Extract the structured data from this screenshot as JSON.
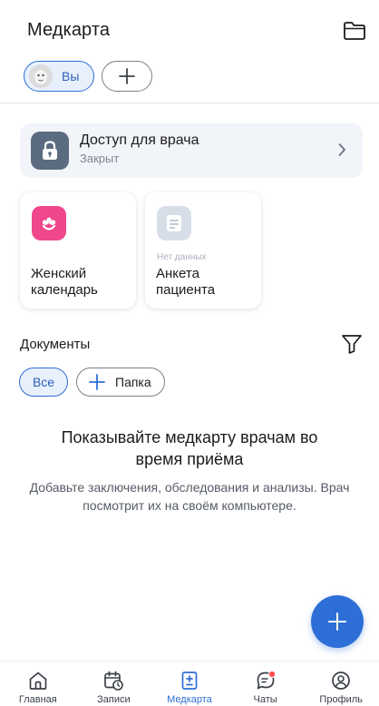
{
  "header": {
    "title": "Медкарта"
  },
  "profiles": {
    "you_label": "Вы"
  },
  "access": {
    "title": "Доступ для врача",
    "status": "Закрыт"
  },
  "tiles": [
    {
      "label": "Женский календарь",
      "nodata": ""
    },
    {
      "label": "Анкета пациента",
      "nodata": "Нет данных"
    }
  ],
  "documents": {
    "title": "Документы",
    "chip_all": "Все",
    "chip_folder": "Папка"
  },
  "empty_state": {
    "title": "Показывайте медкарту врачам во время приёма",
    "description": "Добавьте заключения, обследования и анализы. Врач посмотрит их на своём компьютере."
  },
  "tabbar": {
    "items": [
      {
        "label": "Главная",
        "icon": "home-icon"
      },
      {
        "label": "Записи",
        "icon": "calendar-clock-icon"
      },
      {
        "label": "Медкарта",
        "icon": "medcard-icon",
        "active": true
      },
      {
        "label": "Чаты",
        "icon": "chat-icon"
      },
      {
        "label": "Профиль",
        "icon": "profile-icon"
      }
    ]
  },
  "colors": {
    "accent": "#2d6fd6",
    "chip_bg": "#e8f0fc",
    "card_bg": "#f1f4f9",
    "lock_bg": "#5b6b80",
    "calendar_pink": "#f0468c",
    "form_gray": "#d8dee8",
    "notification_red": "#ff4d4f"
  }
}
